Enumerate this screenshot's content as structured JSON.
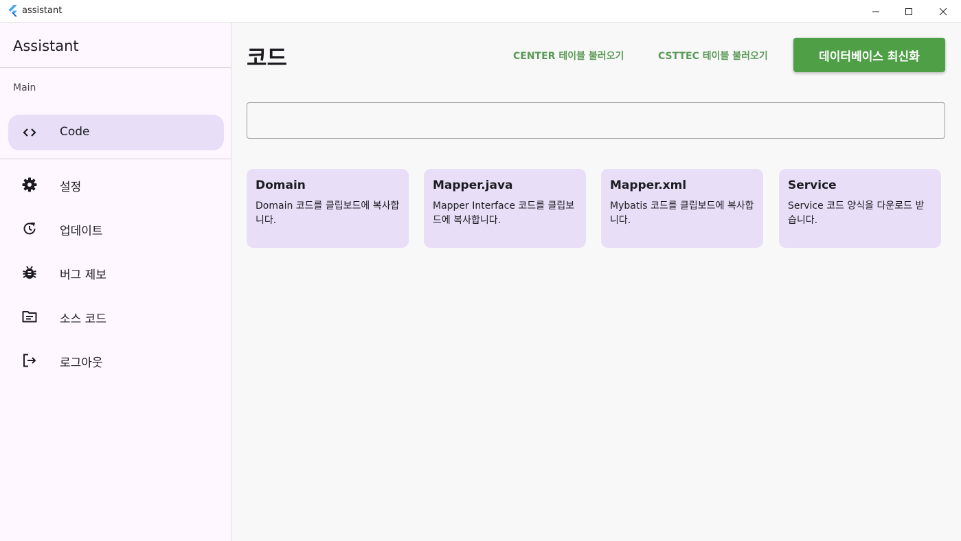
{
  "window": {
    "title": "assistant"
  },
  "sidebar": {
    "title": "Assistant",
    "section_label": "Main",
    "items": [
      {
        "label": "Code",
        "icon": "code-icon",
        "active": true
      },
      {
        "label": "설정",
        "icon": "gear-icon"
      },
      {
        "label": "업데이트",
        "icon": "update-icon"
      },
      {
        "label": "버그 제보",
        "icon": "bug-icon"
      },
      {
        "label": "소스 코드",
        "icon": "folder-icon"
      },
      {
        "label": "로그아웃",
        "icon": "logout-icon"
      }
    ]
  },
  "main": {
    "title": "코드",
    "actions": {
      "center_load": "CENTER 테이블 불러오기",
      "csttec_load": "CSTTEC 테이블 불러오기",
      "refresh_db": "데이터베이스 최신화"
    },
    "search": {
      "value": "",
      "placeholder": ""
    },
    "cards": [
      {
        "title": "Domain",
        "description": "Domain 코드를 클립보드에 복사합니다."
      },
      {
        "title": "Mapper.java",
        "description": "Mapper Interface 코드를 클립보드에 복사합니다."
      },
      {
        "title": "Mapper.xml",
        "description": "Mybatis 코드를 클립보드에 복사합니다."
      },
      {
        "title": "Service",
        "description": "Service 코드 양식을 다운로드 받습니다."
      }
    ]
  },
  "colors": {
    "sidebar_bg": "#fef7ff",
    "active_nav_bg": "#e8def8",
    "card_bg": "#e8def8",
    "accent_green": "#4e9f46",
    "text_button_green": "#5b9a57"
  }
}
